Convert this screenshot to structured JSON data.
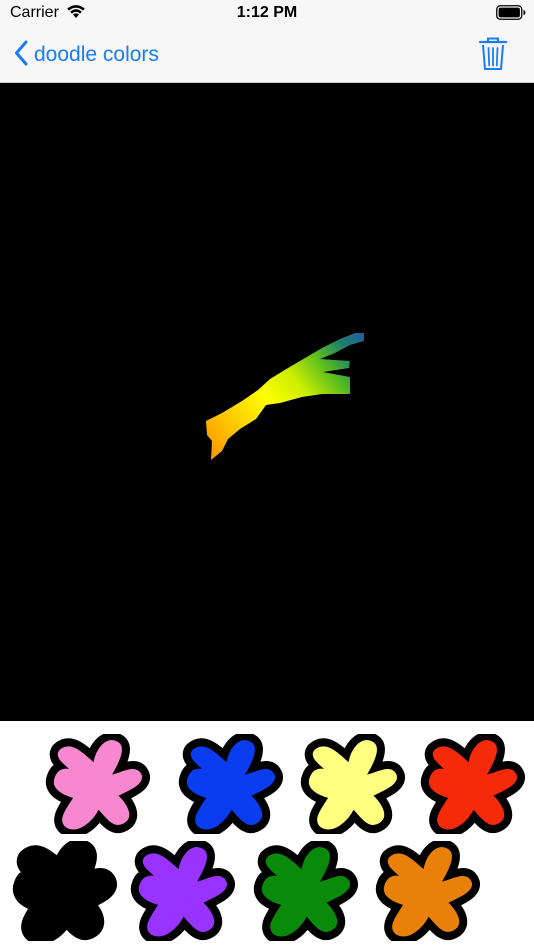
{
  "status_bar": {
    "carrier": "Carrier",
    "time": "1:12 PM"
  },
  "nav": {
    "back_label": "doodle colors",
    "accent_color": "#1a7cf5"
  },
  "canvas": {
    "background": "#000000",
    "stroke_gradient": [
      "#ff9a00",
      "#ffcc00",
      "#ffff00",
      "#ccee00",
      "#55bb22",
      "#1f7f6a",
      "#1f5fa0"
    ]
  },
  "palette": {
    "swatches": [
      {
        "name": "pink",
        "color": "#f788cf"
      },
      {
        "name": "blue",
        "color": "#0a3cf0"
      },
      {
        "name": "light-yellow",
        "color": "#ffff80"
      },
      {
        "name": "red",
        "color": "#f52a0a"
      },
      {
        "name": "black",
        "color": "#000000"
      },
      {
        "name": "purple",
        "color": "#9933ff"
      },
      {
        "name": "green",
        "color": "#0a8a0a"
      },
      {
        "name": "orange",
        "color": "#e8800a"
      }
    ]
  }
}
